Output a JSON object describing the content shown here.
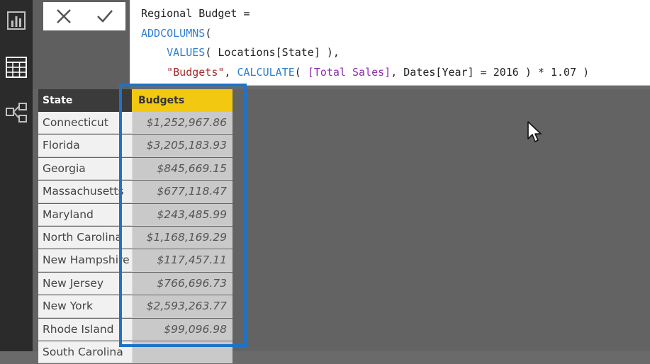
{
  "formula_bar": {
    "lines": [
      {
        "segments": [
          {
            "text": "Regional Budget =",
            "style": "plain"
          }
        ]
      },
      {
        "segments": [
          {
            "text": "ADDCOLUMNS",
            "style": "kw"
          },
          {
            "text": "(",
            "style": "plain"
          }
        ]
      },
      {
        "segments": [
          {
            "text": "    ",
            "style": "plain"
          },
          {
            "text": "VALUES",
            "style": "kw"
          },
          {
            "text": "( Locations[State] ),",
            "style": "plain"
          }
        ]
      },
      {
        "segments": [
          {
            "text": "    ",
            "style": "plain"
          },
          {
            "text": "\"Budgets\"",
            "style": "str"
          },
          {
            "text": ", ",
            "style": "plain"
          },
          {
            "text": "CALCULATE",
            "style": "kw"
          },
          {
            "text": "( ",
            "style": "plain"
          },
          {
            "text": "[Total Sales]",
            "style": "col"
          },
          {
            "text": ", Dates[Year] = 2016 ) * 1.07 )",
            "style": "plain"
          }
        ]
      }
    ]
  },
  "table": {
    "headers": {
      "state": "State",
      "budgets": "Budgets"
    },
    "rows": [
      {
        "state": "Connecticut",
        "budget": "$1,252,967.86"
      },
      {
        "state": "Florida",
        "budget": "$3,205,183.93"
      },
      {
        "state": "Georgia",
        "budget": "$845,669.15"
      },
      {
        "state": "Massachusetts",
        "budget": "$677,118.47"
      },
      {
        "state": "Maryland",
        "budget": "$243,485.99"
      },
      {
        "state": "North Carolina",
        "budget": "$1,168,169.29"
      },
      {
        "state": "New Hampshire",
        "budget": "$117,457.11"
      },
      {
        "state": "New Jersey",
        "budget": "$766,696.73"
      },
      {
        "state": "New York",
        "budget": "$2,593,263.77"
      },
      {
        "state": "Rhode Island",
        "budget": "$99,096.98"
      },
      {
        "state": "South Carolina",
        "budget": ""
      }
    ]
  },
  "icons": {
    "sidebar": [
      "report-view-icon",
      "data-view-icon",
      "relationships-view-icon"
    ],
    "formula": [
      "cancel-icon",
      "commit-icon"
    ]
  },
  "colors": {
    "header_accent": "#f2c811",
    "highlight_border": "#1e73c9",
    "keyword": "#2f7fd1",
    "string": "#a52a2a",
    "column_ref": "#8a2da8"
  }
}
